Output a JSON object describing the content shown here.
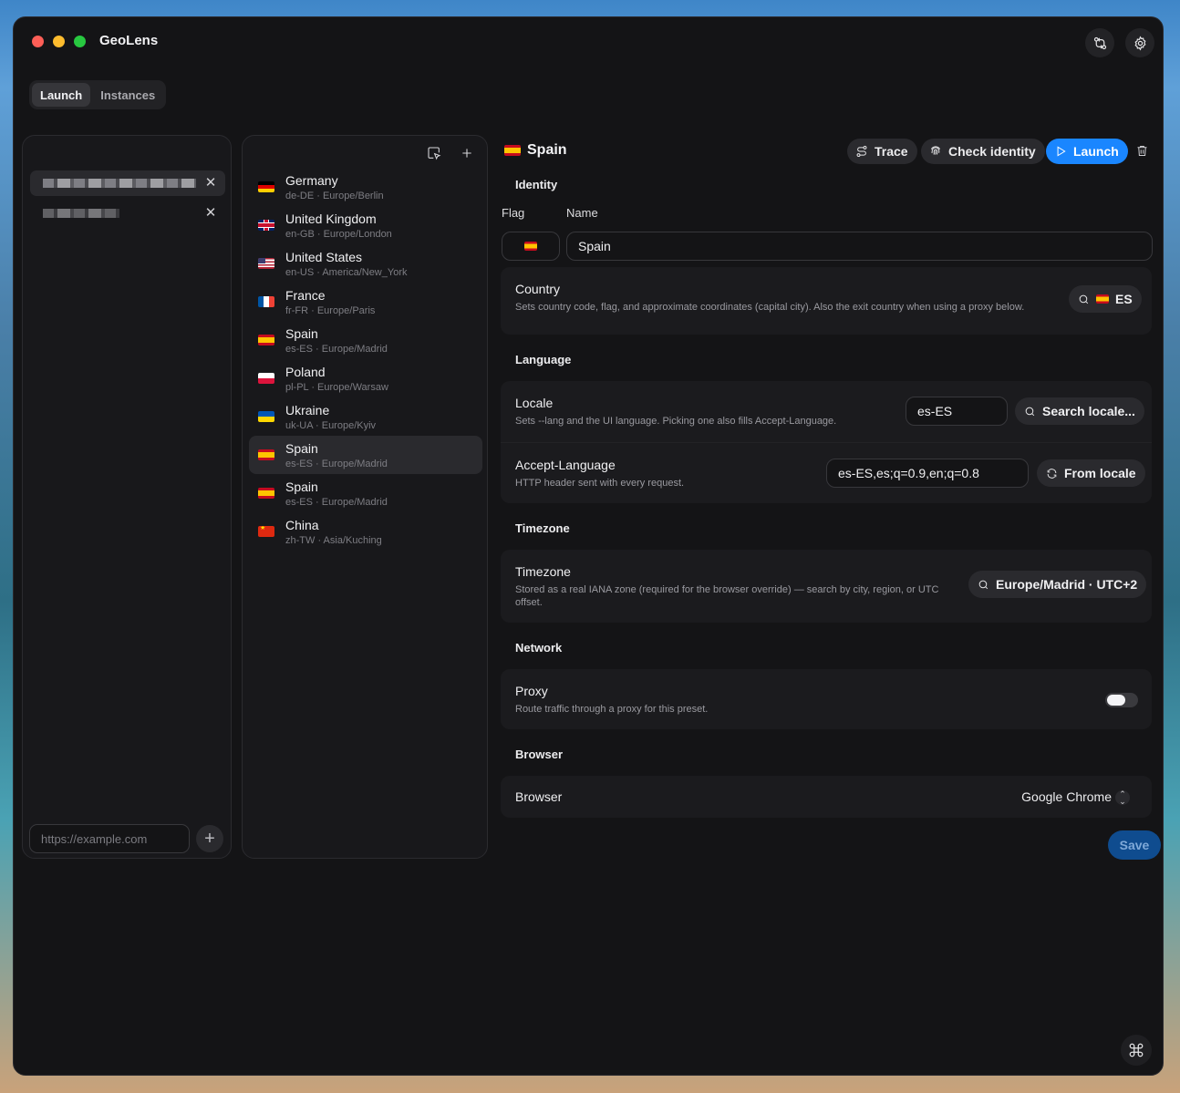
{
  "app": {
    "title": "GeoLens"
  },
  "tabs": [
    {
      "label": "Launch",
      "active": true
    },
    {
      "label": "Instances",
      "active": false
    }
  ],
  "sites": {
    "url_placeholder": "https://example.com"
  },
  "presets": [
    {
      "name": "Germany",
      "sub": "de-DE · Europe/Berlin",
      "flag": "de"
    },
    {
      "name": "United Kingdom",
      "sub": "en-GB · Europe/London",
      "flag": "gb"
    },
    {
      "name": "United States",
      "sub": "en-US · America/New_York",
      "flag": "us"
    },
    {
      "name": "France",
      "sub": "fr-FR · Europe/Paris",
      "flag": "fr"
    },
    {
      "name": "Spain",
      "sub": "es-ES · Europe/Madrid",
      "flag": "es"
    },
    {
      "name": "Poland",
      "sub": "pl-PL · Europe/Warsaw",
      "flag": "pl"
    },
    {
      "name": "Ukraine",
      "sub": "uk-UA · Europe/Kyiv",
      "flag": "ua"
    },
    {
      "name": "Spain",
      "sub": "es-ES · Europe/Madrid",
      "flag": "es",
      "active": true
    },
    {
      "name": "Spain",
      "sub": "es-ES · Europe/Madrid",
      "flag": "es"
    },
    {
      "name": "China",
      "sub": "zh-TW · Asia/Kuching",
      "flag": "cn"
    }
  ],
  "editor": {
    "title": "Spain",
    "buttons": {
      "trace": "Trace",
      "check_identity": "Check identity",
      "launch": "Launch"
    },
    "identity": {
      "section": "Identity",
      "flag_label": "Flag",
      "name_label": "Name",
      "name_value": "Spain"
    },
    "country": {
      "title": "Country",
      "desc": "Sets country code, flag, and approximate coordinates (capital city). Also the exit country when using a proxy below.",
      "value": "ES"
    },
    "language": {
      "section": "Language",
      "locale_title": "Locale",
      "locale_desc": "Sets --lang and the UI language. Picking one also fills Accept-Language.",
      "locale_value": "es-ES",
      "search_locale": "Search locale...",
      "accept_title": "Accept-Language",
      "accept_desc": "HTTP header sent with every request.",
      "accept_value": "es-ES,es;q=0.9,en;q=0.8",
      "from_locale": "From locale"
    },
    "timezone": {
      "section": "Timezone",
      "title": "Timezone",
      "desc": "Stored as a real IANA zone (required for the browser override) — search by city, region, or UTC offset.",
      "value": "Europe/Madrid · UTC+2"
    },
    "network": {
      "section": "Network",
      "proxy_title": "Proxy",
      "proxy_desc": "Route traffic through a proxy for this preset.",
      "proxy_enabled": false
    },
    "browser": {
      "section": "Browser",
      "title": "Browser",
      "value": "Google Chrome"
    },
    "save": "Save"
  }
}
